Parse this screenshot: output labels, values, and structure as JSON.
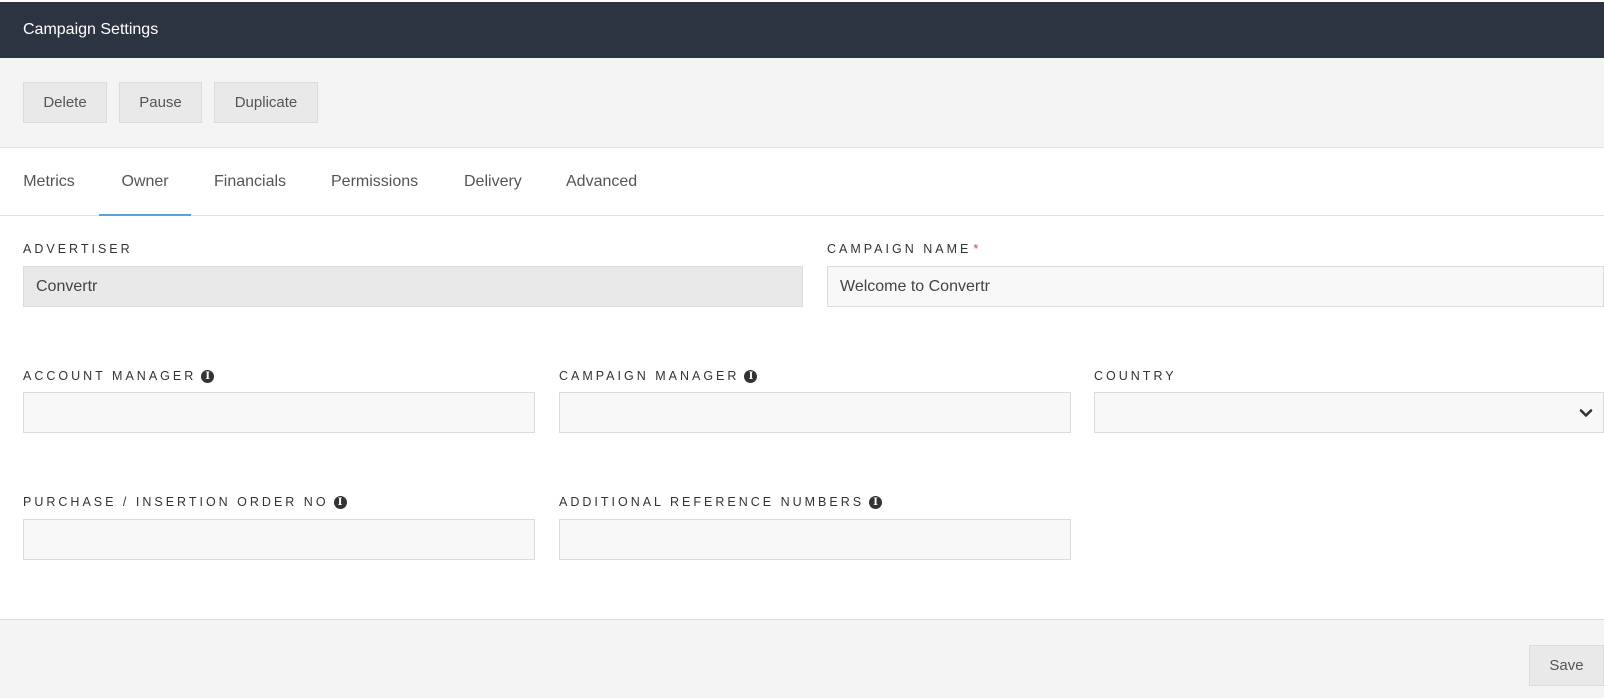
{
  "header": {
    "title": "Campaign Settings"
  },
  "actions": {
    "delete": "Delete",
    "pause": "Pause",
    "duplicate": "Duplicate"
  },
  "tabs": [
    {
      "label": "Metrics"
    },
    {
      "label": "Owner",
      "active": true
    },
    {
      "label": "Financials"
    },
    {
      "label": "Permissions"
    },
    {
      "label": "Delivery"
    },
    {
      "label": "Advanced"
    }
  ],
  "form": {
    "advertiser": {
      "label": "Advertiser",
      "value": "Convertr"
    },
    "campaign_name": {
      "label": "Campaign Name",
      "required_mark": "*",
      "value": "Welcome to Convertr"
    },
    "account_manager": {
      "label": "Account Manager",
      "value": ""
    },
    "campaign_manager": {
      "label": "Campaign Manager",
      "value": ""
    },
    "country": {
      "label": "Country",
      "value": ""
    },
    "purchase_order": {
      "label": "Purchase / Insertion Order No",
      "value": ""
    },
    "additional_refs": {
      "label": "Additional Reference Numbers",
      "value": ""
    }
  },
  "footer": {
    "save": "Save"
  },
  "colors": {
    "header_bg": "#2d3441",
    "tab_active": "#5aa3d8",
    "required": "#e0413e"
  },
  "icons": {
    "info": "info-icon",
    "dropdown": "chevron-down-icon"
  }
}
